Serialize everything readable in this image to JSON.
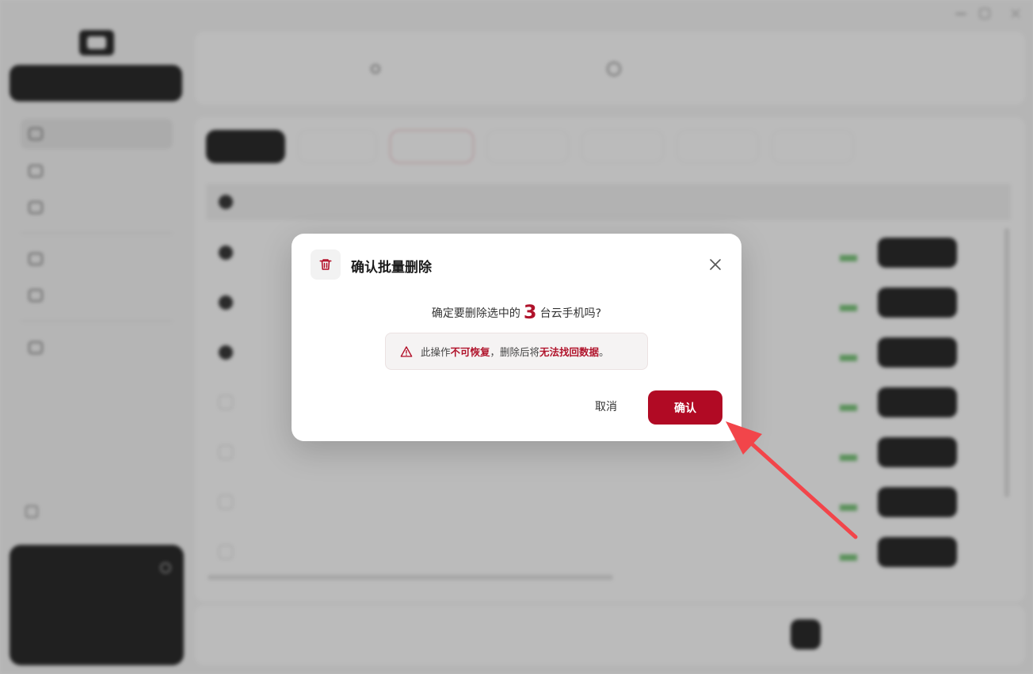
{
  "modal": {
    "title": "确认批量删除",
    "message_prefix": "确定要删除选中的",
    "count": "3",
    "message_suffix": "台云手机吗?",
    "warning": {
      "part1": "此操作",
      "highlight1": "不可恢复",
      "part2": "，删除后将",
      "highlight2": "无法找回数据",
      "part3": "。"
    },
    "cancel_label": "取消",
    "confirm_label": "确认"
  },
  "colors": {
    "danger": "#b10a24",
    "overlay": "rgba(60,60,60,0.35)",
    "arrow": "#f2454a"
  },
  "icons": {
    "modal_icon": "trash-icon",
    "close": "close-icon",
    "warning": "warning-triangle-icon"
  }
}
